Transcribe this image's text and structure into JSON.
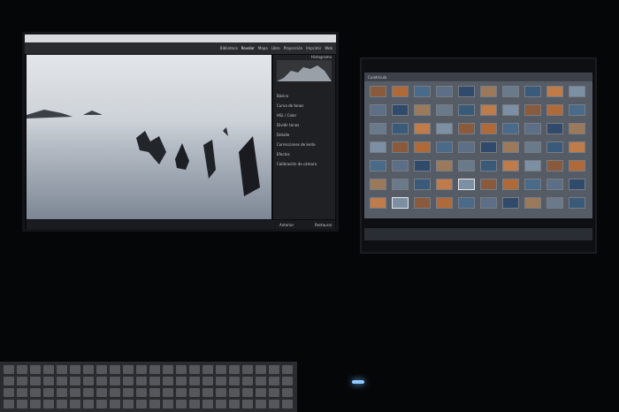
{
  "left_screen": {
    "module_picker": [
      "Biblioteca",
      "Revelar",
      "Mapa",
      "Libro",
      "Proyección",
      "Imprimir",
      "Web"
    ],
    "histogram_label": "Histograma",
    "right_panel_sections": [
      "Básico",
      "Curva de tonos",
      "HSL / Color",
      "Dividir tonos",
      "Detalle",
      "Correcciones de lente",
      "Efectos",
      "Calibración de cámara"
    ],
    "bottom_buttons": [
      "Anterior",
      "Restaurar"
    ]
  },
  "right_screen": {
    "view_label": "Cuadrícula",
    "thumb_rows": 7,
    "thumb_cols": 10
  },
  "colors": {
    "background": "#050608",
    "screen_glow": "#9fb0c4",
    "led": "#8fc9ff"
  }
}
